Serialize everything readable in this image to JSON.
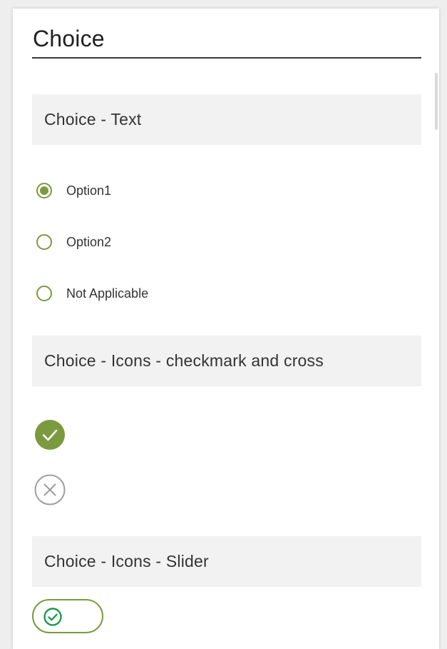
{
  "page": {
    "title": "Choice"
  },
  "sections": {
    "text": {
      "header": "Choice - Text",
      "options": [
        {
          "label": "Option1",
          "selected": true
        },
        {
          "label": "Option2",
          "selected": false
        },
        {
          "label": "Not Applicable",
          "selected": false
        }
      ]
    },
    "icons": {
      "header": "Choice - Icons - checkmark and cross",
      "check_icon": "checkmark-circle-icon",
      "cross_icon": "cross-circle-icon",
      "check_selected": true
    },
    "slider": {
      "header": "Choice - Icons - Slider",
      "knob_icon": "checkmark-circle-icon",
      "position": "left"
    }
  },
  "colors": {
    "accent": "#7b9a3f",
    "section_bg": "#f2f2f2",
    "muted_icon": "#9e9e9e",
    "slider_icon": "#1d9b4f"
  }
}
